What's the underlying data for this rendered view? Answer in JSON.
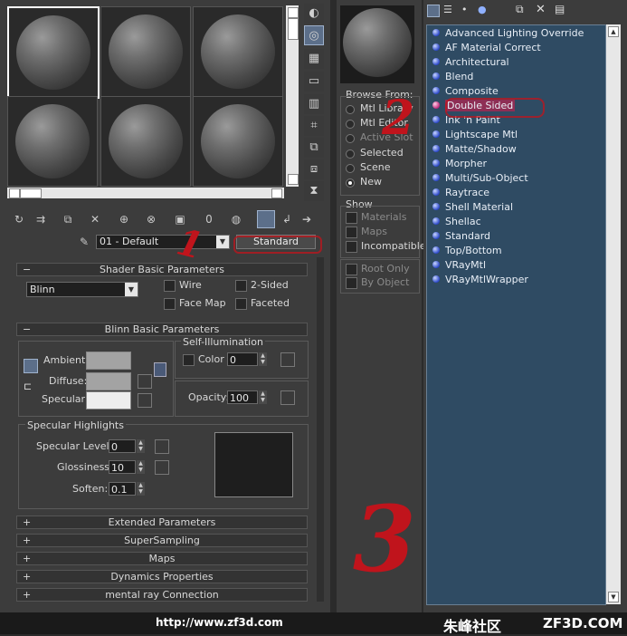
{
  "left": {
    "material_name": "01 - Default",
    "material_type": "Standard",
    "shader_rollout": "Shader Basic Parameters",
    "shader": "Blinn",
    "wire": "Wire",
    "two_sided": "2-Sided",
    "face_map": "Face Map",
    "faceted": "Faceted",
    "blinn_rollout": "Blinn Basic Parameters",
    "ambient": "Ambient:",
    "diffuse": "Diffuse:",
    "specular": "Specular:",
    "self_illum": "Self-Illumination",
    "color": "Color",
    "color_val": "0",
    "opacity": "Opacity:",
    "opacity_val": "100",
    "spec_highlights": "Specular Highlights",
    "spec_level": "Specular Level:",
    "spec_level_val": "0",
    "glossiness": "Glossiness:",
    "glossiness_val": "10",
    "soften": "Soften:",
    "soften_val": "0.1",
    "rollouts": [
      "Extended Parameters",
      "SuperSampling",
      "Maps",
      "Dynamics Properties",
      "mental ray Connection"
    ],
    "minus": "−",
    "plus": "+",
    "ambient_color": "#a3a3a3",
    "diffuse_color": "#a3a3a3",
    "specular_color": "#ededed"
  },
  "browse": {
    "browse_from": "Browse From:",
    "sources": [
      "Mtl Library",
      "Mtl Editor",
      "Active Slot",
      "Selected",
      "Scene",
      "New"
    ],
    "show": "Show",
    "show_items": [
      "Materials",
      "Maps",
      "Incompatible"
    ],
    "root_only": "Root Only",
    "by_object": "By Object"
  },
  "list": {
    "items": [
      "Advanced Lighting Override",
      "AF Material Correct",
      "Architectural",
      "Blend",
      "Composite",
      "Double Sided",
      "Ink 'n Paint",
      "Lightscape Mtl",
      "Matte/Shadow",
      "Morpher",
      "Multi/Sub-Object",
      "Raytrace",
      "Shell Material",
      "Shellac",
      "Standard",
      "Top/Bottom",
      "VRayMtl",
      "VRayMtlWrapper"
    ],
    "selected_index": 5,
    "selected_color": "#8e2e55"
  },
  "footer": {
    "url": "http://www.zf3d.com",
    "brand_cn": "朱峰社区",
    "brand_en": "ZF3D.COM"
  },
  "annotations": {
    "one": "1",
    "two": "2",
    "three": "3"
  }
}
